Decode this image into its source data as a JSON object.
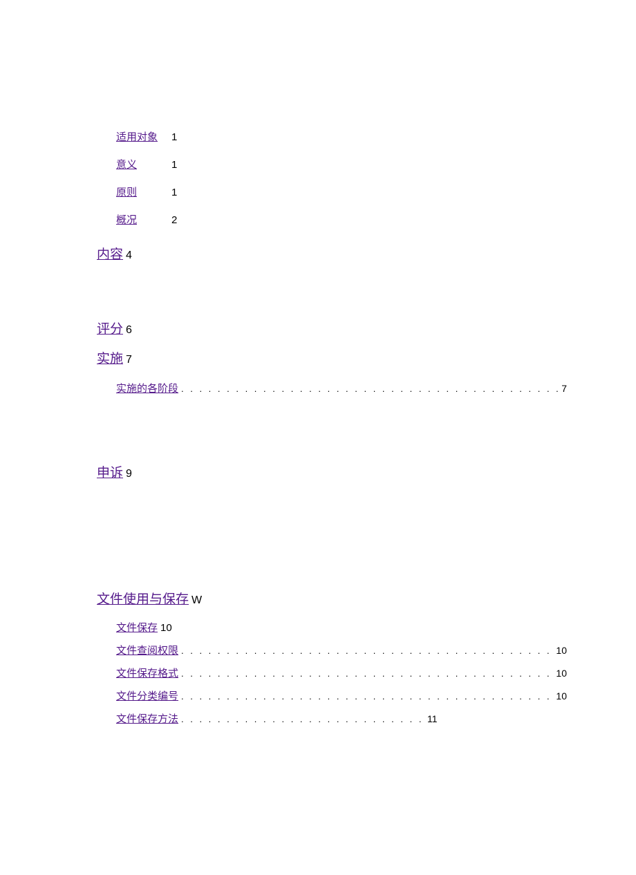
{
  "toc": {
    "sub_items": [
      {
        "label": "适用对象",
        "page": "1"
      },
      {
        "label": "意义",
        "page": "1"
      },
      {
        "label": "原则",
        "page": "1"
      },
      {
        "label": "概况",
        "page": "2"
      }
    ],
    "content": {
      "label": "内容",
      "page": "4"
    },
    "scoring": {
      "label": "评分",
      "page": "6"
    },
    "implement": {
      "label": "实施",
      "page": "7"
    },
    "implement_sub": {
      "label": "实施的各阶段",
      "page": "7"
    },
    "appeal": {
      "label": "申诉",
      "page": "9"
    },
    "files": {
      "label": "文件使用与保存",
      "page": "W"
    },
    "files_sub_top": {
      "label": "文件保存",
      "page": "10"
    },
    "files_subs": [
      {
        "label": "文件查阅权限",
        "page": "10"
      },
      {
        "label": "文件保存格式",
        "page": "10"
      },
      {
        "label": "文件分类编号",
        "page": "10"
      }
    ],
    "files_last": {
      "label": "文件保存方法",
      "page": "11"
    }
  },
  "dots": ". . . . . . . . . . . . . . . . . . . . . . . . . . . . . . . . . . . . . . . . . . . . . . . . . . . . . . . . . . . . . . . . . . . . . . . . . . . . . . . ."
}
